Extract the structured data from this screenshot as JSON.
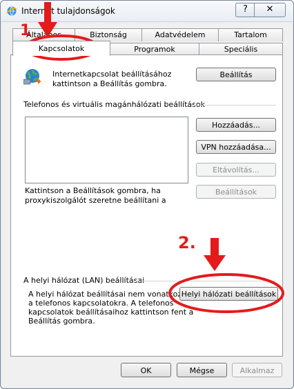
{
  "window": {
    "title": "Internet tulajdonságok",
    "help_label": "?",
    "close_label": "✕"
  },
  "tabs": {
    "row_back": [
      "Általános",
      "Biztonság",
      "Adatvédelem",
      "Tartalom"
    ],
    "row_front": [
      "Kapcsolatok",
      "Programok",
      "Speciális"
    ],
    "selected": "Kapcsolatok"
  },
  "connections": {
    "setup_text": "Internetkapcsolat beállításához kattintson a Beállítás gombra.",
    "setup_button": "Beállítás",
    "vpn_header": "Telefonos és virtuális magánhálózati beállítások",
    "add_button": "Hozzáadás...",
    "add_vpn_button": "VPN hozzáadása...",
    "remove_button": "Eltávolítás...",
    "settings_button": "Beállítások",
    "proxy_text_1": "Kattintson a Beállítások gombra, ha",
    "proxy_text_2": "proxykiszolgálót szeretne beállítani a",
    "lan_header": "A helyi hálózat (LAN) beállításai",
    "lan_text_1": "A helyi hálózat beállításai nem vonatkozna",
    "lan_text_2": "a telefonos kapcsolatokra. A telefonos",
    "lan_text_3": "kapcsolatok beállításaihoz kattintson fent a",
    "lan_text_4": "Beállítás gombra.",
    "lan_button": "Helyi hálózati beállítások"
  },
  "footer": {
    "ok": "OK",
    "cancel": "Mégse",
    "apply": "Alkalmaz"
  },
  "annotations": {
    "step1": "1",
    "step2": "2.",
    "color": "#e41b1b"
  }
}
